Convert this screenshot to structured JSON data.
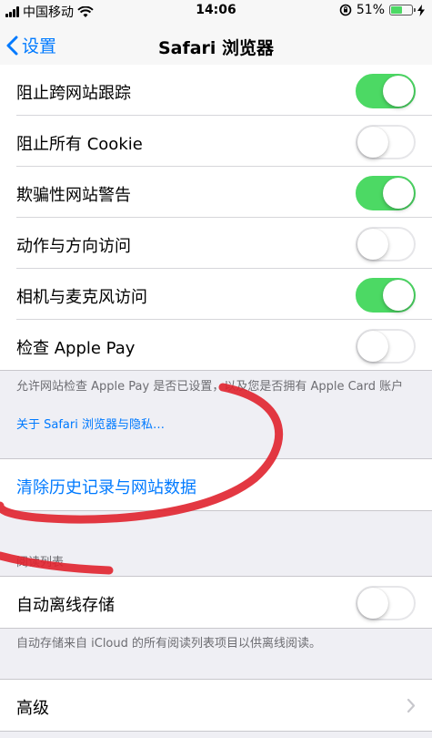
{
  "status_bar": {
    "carrier": "中国移动",
    "time": "14:06",
    "battery": "51%"
  },
  "nav": {
    "back_label": "设置",
    "title": "Safari 浏览器"
  },
  "privacy_rows": [
    {
      "label": "阻止跨网站跟踪",
      "on": true
    },
    {
      "label": "阻止所有 Cookie",
      "on": false
    },
    {
      "label": "欺骗性网站警告",
      "on": true
    },
    {
      "label": "动作与方向访问",
      "on": false
    },
    {
      "label": "相机与麦克风访问",
      "on": true
    },
    {
      "label": "检查 Apple Pay",
      "on": false
    }
  ],
  "privacy_footer": {
    "note": "允许网站检查 Apple Pay 是否已设置，以及您是否拥有 Apple Card 账户",
    "link": "关于 Safari 浏览器与隐私…"
  },
  "clear_history": {
    "label": "清除历史记录与网站数据"
  },
  "reading_list": {
    "header": "阅读列表",
    "row": {
      "label": "自动离线存储",
      "on": false
    },
    "note": "自动存储来自 iCloud 的所有阅读列表项目以供离线阅读。"
  },
  "advanced": {
    "label": "高级"
  },
  "colors": {
    "accent": "#007aff",
    "toggle_on": "#4cd964",
    "annotation": "#e0222e"
  }
}
